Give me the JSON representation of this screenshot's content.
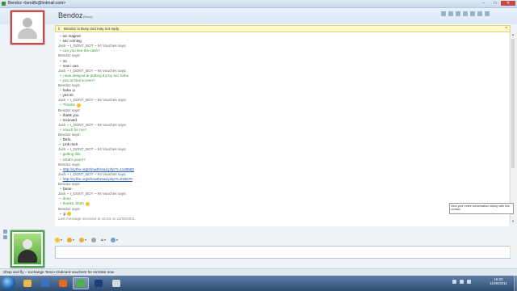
{
  "window": {
    "title": "Bendoz <bendfc@hotmail.com>",
    "controls": {
      "minimize": "–",
      "maximize": "□",
      "close": "✕"
    }
  },
  "contact": {
    "name": "Bendoz",
    "status": "(Busy)"
  },
  "notice": {
    "text": "Bendoz is Busy and may not reply.",
    "icon": "info-icon",
    "close": "×"
  },
  "conversation": [
    {
      "type": "msg",
      "color": "dark",
      "text": "wc magnet"
    },
    {
      "type": "msg",
      "color": "dark",
      "text": "sec coming"
    },
    {
      "type": "who",
      "text": "Jack ~ I_DONT_BOT ~ 94 Vouches says:"
    },
    {
      "type": "msg",
      "color": "green",
      "text": "can you see the cash?"
    },
    {
      "type": "who",
      "text": "Bendoz says:"
    },
    {
      "type": "msg",
      "color": "dark",
      "text": "no"
    },
    {
      "type": "msg",
      "color": "dark",
      "text": "now i can."
    },
    {
      "type": "who",
      "text": "Jack ~ I_DONT_BOT ~ 94 Vouches says:"
    },
    {
      "type": "msg",
      "color": "green",
      "text": "i was delayed at putting it p by acc haha"
    },
    {
      "type": "msg",
      "color": "green",
      "text": "you at final screen?"
    },
    {
      "type": "who",
      "text": "Bendoz says:"
    },
    {
      "type": "msg",
      "color": "dark",
      "text": "haha :p"
    },
    {
      "type": "msg",
      "color": "dark",
      "text": "yes sir."
    },
    {
      "type": "who",
      "text": "Jack ~ I_DONT_BOT ~ 94 Vouches says:"
    },
    {
      "type": "msg",
      "color": "green",
      "text": "Thanks",
      "emoticon": true
    },
    {
      "type": "who",
      "text": "Bendoz says:"
    },
    {
      "type": "msg",
      "color": "dark",
      "text": "thank you"
    },
    {
      "type": "msg",
      "color": "dark",
      "text": "recieved."
    },
    {
      "type": "who",
      "text": "Jack ~ I_DONT_BOT ~ 94 Vouches says:"
    },
    {
      "type": "msg",
      "color": "green",
      "text": "Vouch for me?"
    },
    {
      "type": "who",
      "text": "Bendoz says:"
    },
    {
      "type": "msg",
      "color": "dark",
      "text": "Defo."
    },
    {
      "type": "msg",
      "color": "dark",
      "text": "Link meh"
    },
    {
      "type": "who",
      "text": "Jack ~ I_DONT_BOT ~ 94 Vouches says:"
    },
    {
      "type": "msg",
      "color": "green",
      "text": "getting link."
    },
    {
      "type": "msg",
      "color": "green",
      "text": "what's yours?"
    },
    {
      "type": "who",
      "text": "Bendoz says:"
    },
    {
      "type": "msg",
      "color": "link",
      "text": "http://sythe.org/showthread.php?t=1148580"
    },
    {
      "type": "who",
      "text": "Jack ~ I_DONT_BOT ~ 94 Vouches says:"
    },
    {
      "type": "msg",
      "color": "link",
      "text": "http://sythe.org/showthread.php?t=819570"
    },
    {
      "type": "who",
      "text": "Bendoz says:"
    },
    {
      "type": "msg",
      "color": "dark",
      "text": "Done."
    },
    {
      "type": "who",
      "text": "Jack ~ I_DONT_BOT ~ 94 Vouches says:"
    },
    {
      "type": "msg",
      "color": "green",
      "text": "done"
    },
    {
      "type": "msg",
      "color": "green",
      "text": "thanks. bb4n",
      "emoticon": true
    },
    {
      "type": "who",
      "text": "Bendoz says:"
    },
    {
      "type": "msg",
      "color": "dark",
      "text": ":p",
      "emoticon": true
    },
    {
      "type": "last",
      "text": "Last message received at 16:23 on 11/06/2011."
    }
  ],
  "tooltip": {
    "text": "View your entire conversation history with this contact"
  },
  "toolbar": {
    "items": [
      "emoticon-icon",
      "wink-icon",
      "nudge-icon",
      "font-icon",
      "background-icon"
    ]
  },
  "ad": {
    "text": "Shop and fly – exchange Tesco Clubcard vouchers for Airmiles now"
  },
  "taskbar": {
    "apps": [
      {
        "icon": "explorer-icon",
        "color": "#e9b94a"
      },
      {
        "icon": "media-player-icon",
        "color": "#3a74c4"
      },
      {
        "icon": "firefox-icon",
        "color": "#e46a22"
      },
      {
        "icon": "messenger-icon",
        "color": "#4bb34b"
      },
      {
        "icon": "photoshop-icon",
        "color": "#1d3e7a"
      },
      {
        "icon": "paint-icon",
        "color": "#d8d8d8"
      }
    ],
    "clock_time": "16:23",
    "clock_date": "11/06/2011"
  },
  "colors": {
    "busy_ring": "#d84444",
    "online_ring": "#4aa64a",
    "green_text": "#3b9a3b",
    "link": "#1f55b7"
  }
}
